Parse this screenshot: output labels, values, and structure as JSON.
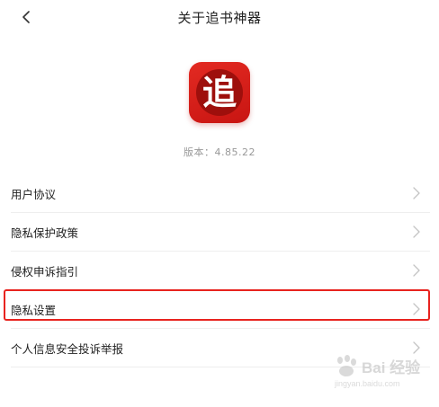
{
  "header": {
    "title": "关于追书神器",
    "back_icon": "chevron-left-icon"
  },
  "app": {
    "logo_char": "追",
    "version_label": "版本：",
    "version_value": "4.85.22",
    "brand_color": "#d81e1a"
  },
  "menu": {
    "items": [
      {
        "label": "用户协议"
      },
      {
        "label": "隐私保护政策"
      },
      {
        "label": "侵权申诉指引"
      },
      {
        "label": "隐私设置"
      },
      {
        "label": "个人信息安全投诉举报"
      }
    ],
    "highlighted_index": 3,
    "highlight_color": "#e8231f"
  },
  "watermark": {
    "text": "Bai 经验",
    "sub": "jingyan.baidu.com"
  }
}
